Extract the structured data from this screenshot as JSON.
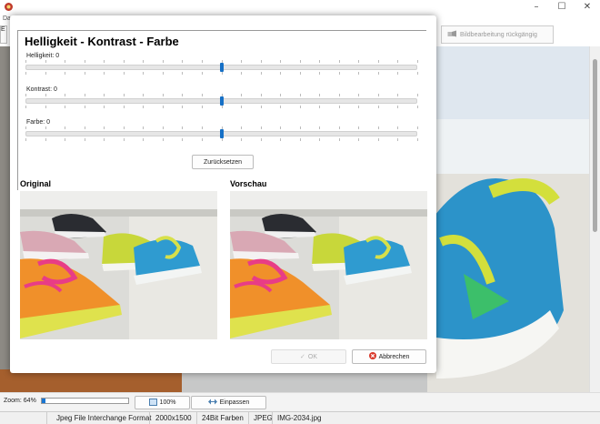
{
  "window": {
    "menu_label": "Da",
    "minimize": "–",
    "maximize": "☐",
    "close": "✕"
  },
  "toolbar": {
    "tab_label": "E",
    "undo_label": "Bildbearbeitung rückgängig"
  },
  "dialog": {
    "title": "Helligkeit - Kontrast - Farbe",
    "sliders": [
      {
        "label": "Helligkeit: 0",
        "value": 0,
        "min": -100,
        "max": 100
      },
      {
        "label": "Kontrast: 0",
        "value": 0,
        "min": -100,
        "max": 100
      },
      {
        "label": "Farbe: 0",
        "value": 0,
        "min": -100,
        "max": 100
      }
    ],
    "reset_label": "Zurücksetzen",
    "original_label": "Original",
    "preview_label": "Vorschau",
    "ok_label": "OK",
    "cancel_label": "Abbrechen"
  },
  "zoom": {
    "label": "Zoom: 64%",
    "value_percent": 64,
    "btn_100": "100%",
    "btn_fit": "Einpassen"
  },
  "status": {
    "format": "Jpeg File Interchange Format",
    "dimensions": "2000x1500",
    "bits": "24Bit Farben",
    "type": "JPEG",
    "filename": "IMG-2034.jpg"
  },
  "colors": {
    "accent": "#1670c6",
    "ok_disabled": "#aaaaaa",
    "cancel_icon": "#d9382a"
  }
}
